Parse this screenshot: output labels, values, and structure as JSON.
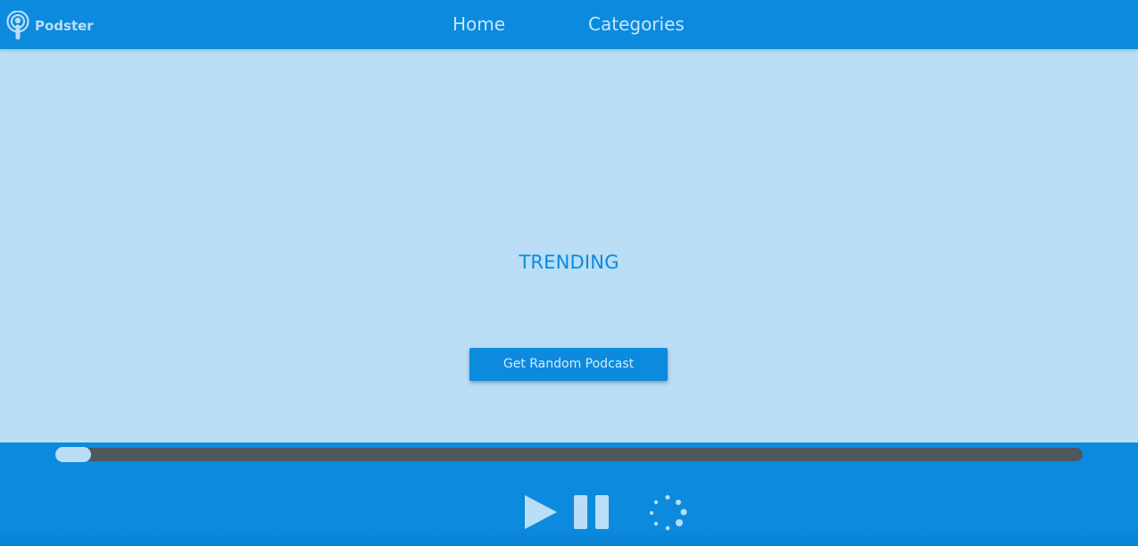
{
  "app": {
    "name": "Podster"
  },
  "header": {
    "nav": [
      {
        "label": "Home"
      },
      {
        "label": "Categories"
      }
    ]
  },
  "main": {
    "section_title": "TRENDING",
    "random_button_label": "Get Random Podcast"
  },
  "player": {
    "progress_fraction": 0.0,
    "controls": [
      {
        "icon": "play-icon"
      },
      {
        "icon": "pause-icon"
      },
      {
        "icon": "loading-spinner-icon"
      }
    ]
  },
  "colors": {
    "primary": "#0b8ade",
    "background": "#b9def6",
    "track": "#4e585f",
    "thumb": "#b9def6"
  }
}
